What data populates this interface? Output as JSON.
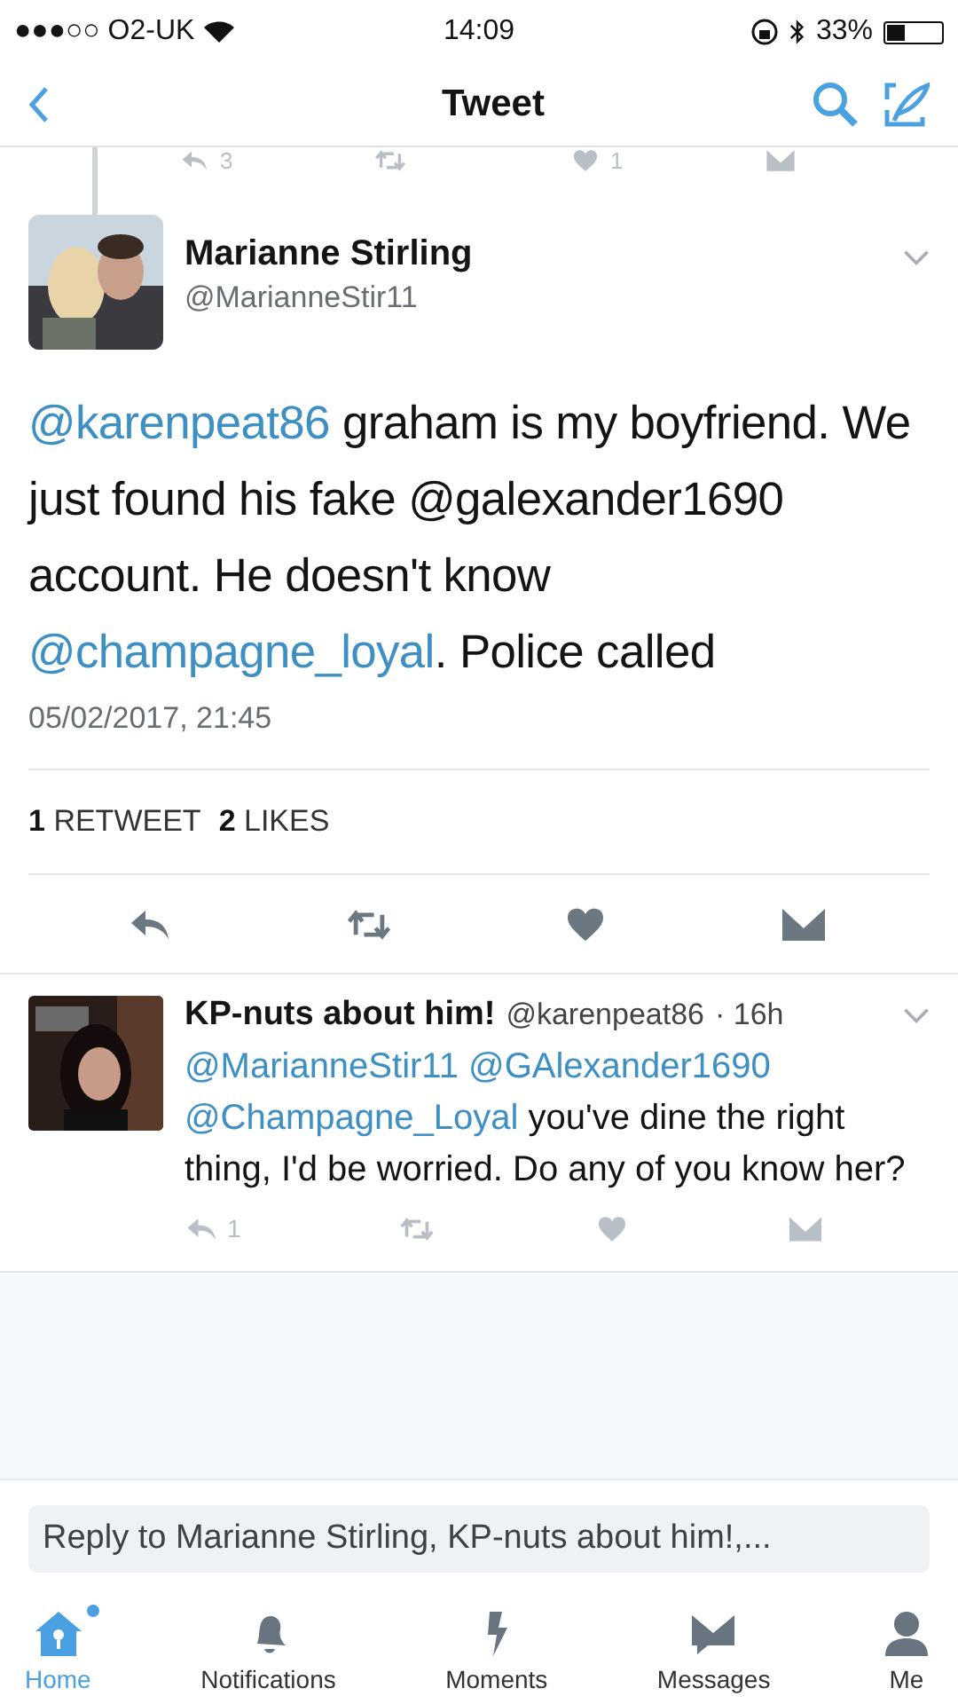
{
  "status_bar": {
    "carrier": "●●●○○ O2-UK",
    "time": "14:09",
    "battery": "33%"
  },
  "nav": {
    "title": "Tweet"
  },
  "previous_actions": [
    {
      "kind": "reply",
      "count": "3"
    },
    {
      "kind": "retweet"
    },
    {
      "kind": "like",
      "count": "1"
    },
    {
      "kind": "message"
    }
  ],
  "tweet": {
    "name": "Marianne Stirling",
    "handle": "@MarianneStir11",
    "body": [
      {
        "kind": "mention",
        "text": "@karenpeat86"
      },
      {
        "kind": "text",
        "text": " graham is my boyfriend. We just found his fake "
      },
      {
        "kind": "text",
        "text": "@galexander1690 account. He doesn't know "
      },
      {
        "kind": "mention",
        "text": "@champagne_loyal"
      },
      {
        "kind": "text",
        "text": ". Police called"
      }
    ],
    "date": "05/02/2017, 21:45",
    "stats": [
      {
        "count": "1",
        "label": "RETWEET"
      },
      {
        "count": "2",
        "label": "LIKES"
      }
    ],
    "actions": [
      {
        "kind": "reply"
      },
      {
        "kind": "retweet"
      },
      {
        "kind": "like"
      },
      {
        "kind": "message"
      }
    ]
  },
  "reply": {
    "name": "KP-nuts about him!",
    "handle": "@karenpeat86",
    "time": "· 16h",
    "body": [
      {
        "kind": "mention",
        "text": "@MarianneStir11"
      },
      {
        "kind": "mention",
        "text": "@GAlexander1690"
      },
      {
        "kind": "mention",
        "text": "@Champagne_Loyal"
      },
      {
        "kind": "text",
        "text": " you've dine the right thing, I'd be worried. Do any of you know her?"
      }
    ],
    "actions": [
      {
        "kind": "reply",
        "count": "1"
      },
      {
        "kind": "retweet"
      },
      {
        "kind": "like"
      },
      {
        "kind": "message"
      }
    ]
  },
  "reply_field": {
    "placeholder": "Reply to Marianne Stirling, KP-nuts about him!,..."
  },
  "tabs": [
    {
      "kind": "home",
      "label": "Home",
      "selected": true,
      "badge": true
    },
    {
      "kind": "bell",
      "label": "Notifications",
      "selected": false,
      "badge": false
    },
    {
      "kind": "bolt",
      "label": "Moments",
      "selected": false,
      "badge": false
    },
    {
      "kind": "message",
      "label": "Messages",
      "selected": false,
      "badge": false
    },
    {
      "kind": "person",
      "label": "Me",
      "selected": false,
      "badge": false
    }
  ]
}
